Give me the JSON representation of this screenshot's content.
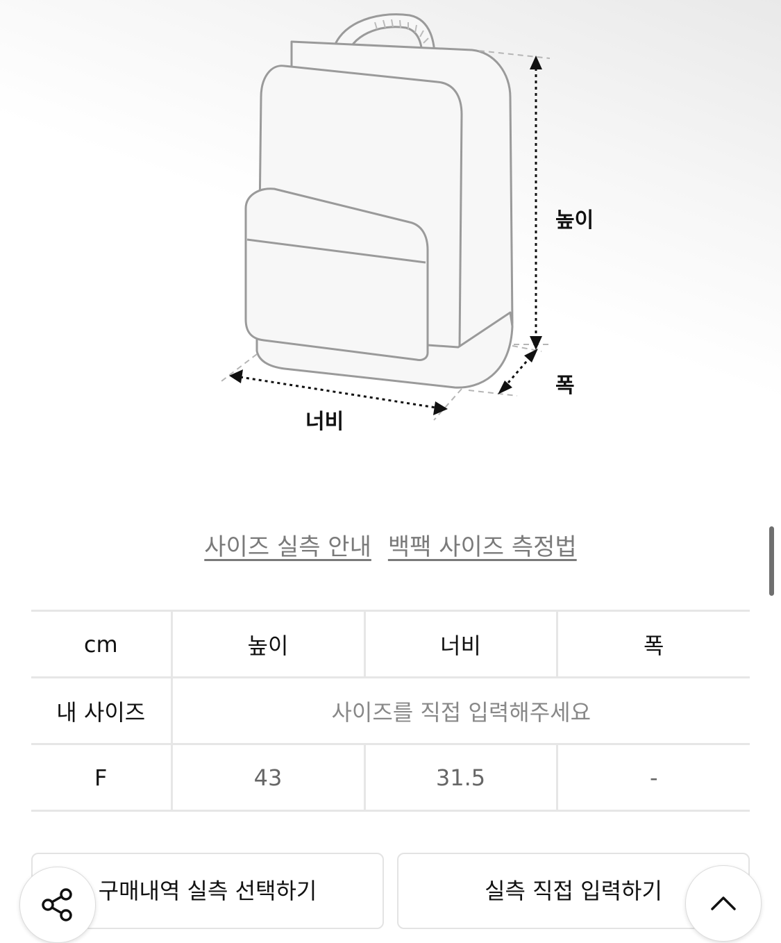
{
  "diagram": {
    "height_label": "높이",
    "width_label": "너비",
    "depth_label": "폭"
  },
  "links": {
    "size_guide": "사이즈 실측 안내",
    "backpack_method": "백팩 사이즈 측정법"
  },
  "table": {
    "headers": [
      "cm",
      "높이",
      "너비",
      "폭"
    ],
    "my_size_label": "내 사이즈",
    "my_size_placeholder": "사이즈를 직접 입력해주세요",
    "rows": [
      {
        "size": "F",
        "height": "43",
        "width": "31.5",
        "depth": "-"
      }
    ]
  },
  "buttons": {
    "purchase_history": "구매내역 실측 선택하기",
    "direct_input": "실측 직접 입력하기"
  },
  "icons": {
    "share": "share-icon",
    "scroll_top": "chevron-up-icon"
  }
}
